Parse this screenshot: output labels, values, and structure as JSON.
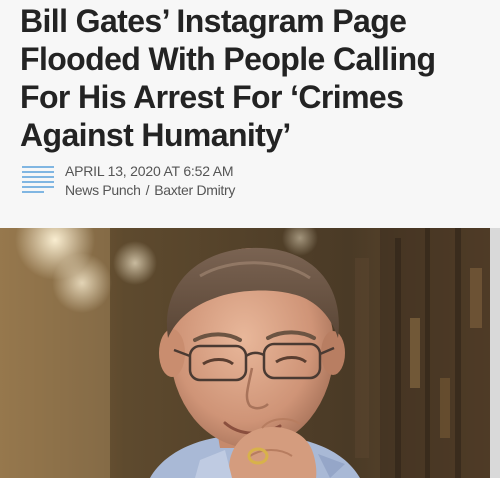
{
  "article": {
    "headline": "Bill Gates’ Instagram Page Flooded With People Calling For His Arrest For ‘Crimes Against Humanity’",
    "date": "APRIL 13, 2020 AT 6:52 AM",
    "source": "News Punch",
    "separator": "/",
    "author": "Baxter Dmitry"
  },
  "icons": {
    "meta": "lines-list-icon"
  },
  "colors": {
    "headline": "#232323",
    "meta_text": "#555555",
    "icon_accent": "#3a8fd6",
    "background": "#f7f7f7"
  }
}
